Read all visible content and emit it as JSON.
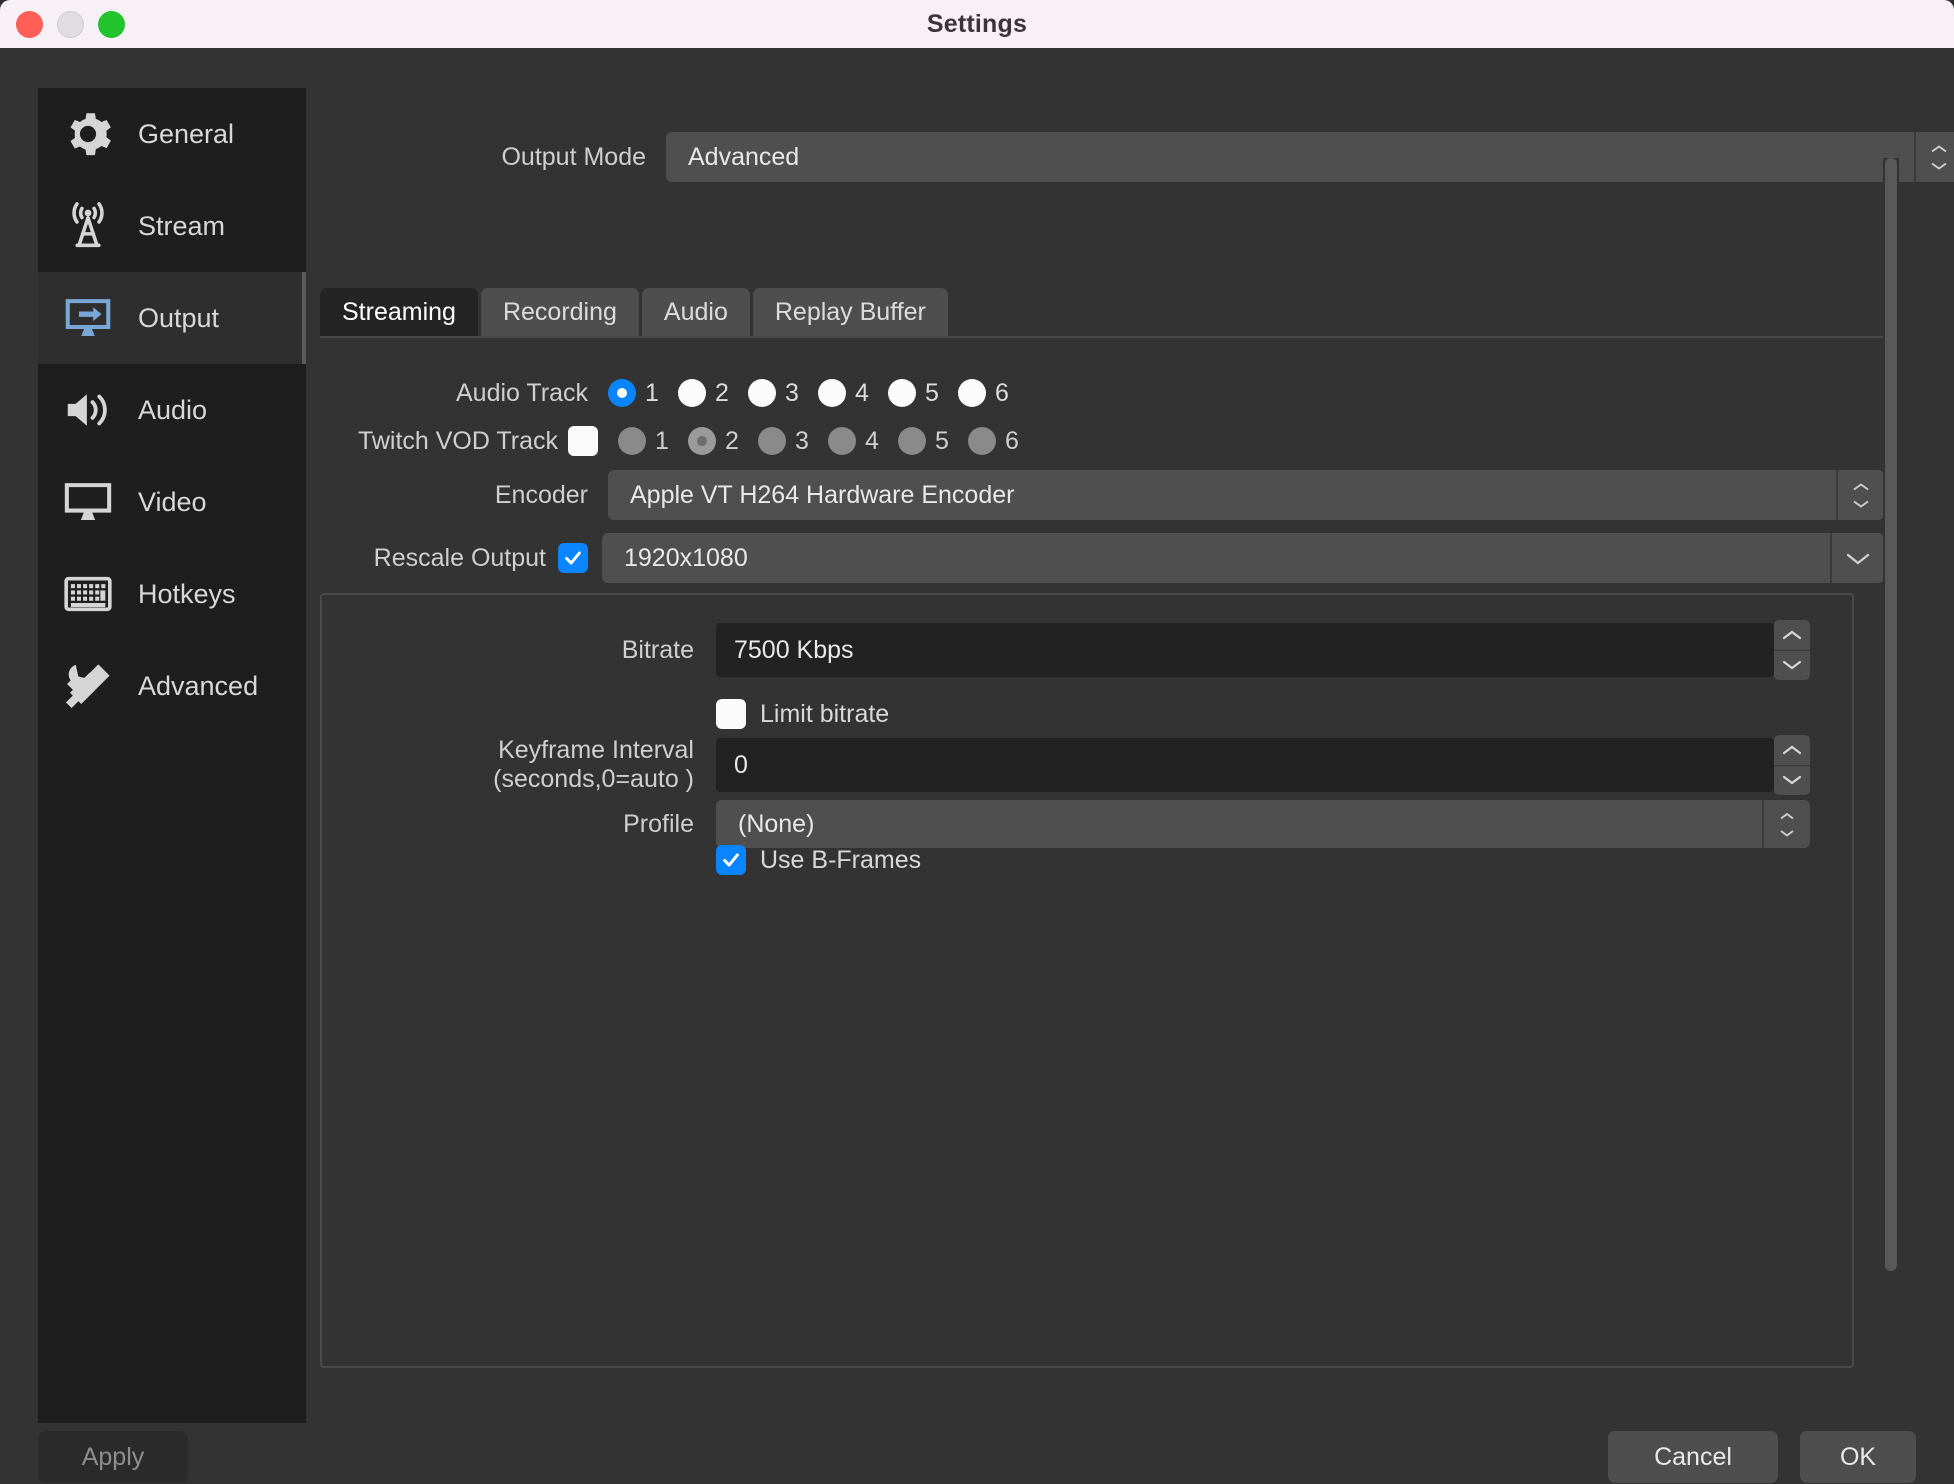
{
  "window": {
    "title": "Settings"
  },
  "traffic_lights": [
    {
      "name": "close-button",
      "color": "#ff5f57"
    },
    {
      "name": "minimize-button",
      "color": "#e0dde0"
    },
    {
      "name": "maximize-button",
      "color": "#22c32c"
    }
  ],
  "sidebar": {
    "items": [
      {
        "label": "General",
        "icon": "gear-icon",
        "selected": false
      },
      {
        "label": "Stream",
        "icon": "antenna-icon",
        "selected": false
      },
      {
        "label": "Output",
        "icon": "output-icon",
        "selected": true
      },
      {
        "label": "Audio",
        "icon": "speaker-icon",
        "selected": false
      },
      {
        "label": "Video",
        "icon": "monitor-icon",
        "selected": false
      },
      {
        "label": "Hotkeys",
        "icon": "keyboard-icon",
        "selected": false
      },
      {
        "label": "Advanced",
        "icon": "tools-icon",
        "selected": false
      }
    ]
  },
  "main": {
    "output_mode": {
      "label": "Output Mode",
      "value": "Advanced"
    },
    "tabs": [
      {
        "label": "Streaming",
        "active": true
      },
      {
        "label": "Recording",
        "active": false
      },
      {
        "label": "Audio",
        "active": false
      },
      {
        "label": "Replay Buffer",
        "active": false
      }
    ],
    "audio_track": {
      "label": "Audio Track",
      "options": [
        "1",
        "2",
        "3",
        "4",
        "5",
        "6"
      ],
      "selected": "1"
    },
    "twitch_vod_track": {
      "label": "Twitch VOD Track",
      "enabled": false,
      "options": [
        "1",
        "2",
        "3",
        "4",
        "5",
        "6"
      ],
      "selected": "2"
    },
    "encoder": {
      "label": "Encoder",
      "value": "Apple VT H264 Hardware Encoder"
    },
    "rescale_output": {
      "label": "Rescale Output",
      "checked": true,
      "value": "1920x1080"
    },
    "encoder_settings": {
      "bitrate": {
        "label": "Bitrate",
        "value": "7500 Kbps"
      },
      "limit_bitrate": {
        "label": "Limit bitrate",
        "checked": false
      },
      "keyframe": {
        "label": "Keyframe Interval (seconds,0=auto )",
        "value": "0"
      },
      "profile": {
        "label": "Profile",
        "value": "(None)"
      },
      "use_b_frames": {
        "label": "Use B-Frames",
        "checked": true
      }
    },
    "annotation": {
      "type": "red-underline",
      "color": "#f5320c",
      "targets": "encoder"
    }
  },
  "footer": {
    "apply": {
      "label": "Apply",
      "enabled": false
    },
    "cancel": {
      "label": "Cancel"
    },
    "ok": {
      "label": "OK"
    }
  },
  "colors": {
    "accent_blue": "#0b84ff",
    "annotation_red": "#f5320c",
    "titlebar_bg": "#f7f0f6",
    "dialog_bg": "#333333",
    "sidebar_bg": "#1e1e1e"
  }
}
